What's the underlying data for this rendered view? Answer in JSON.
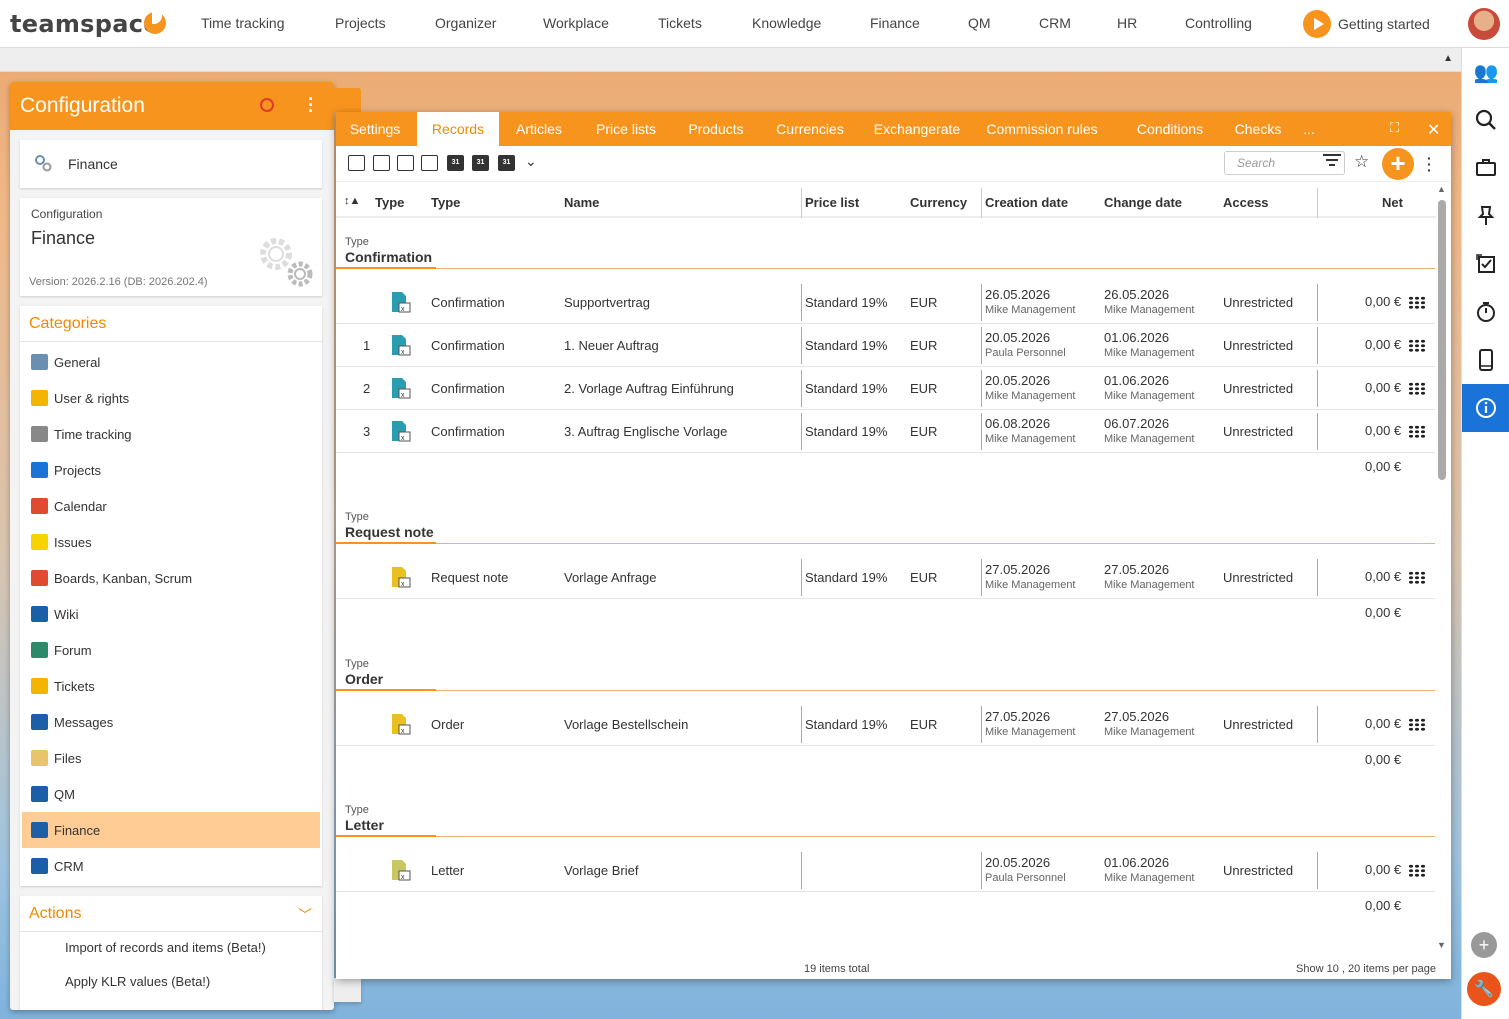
{
  "topbar": {
    "logo": "teamspace",
    "nav": [
      "Time tracking",
      "Projects",
      "Organizer",
      "Workplace",
      "Tickets",
      "Knowledge",
      "Finance",
      "QM",
      "CRM",
      "HR",
      "Controlling"
    ],
    "getting_started": "Getting started"
  },
  "left_panel": {
    "title": "Configuration",
    "current_module": "Finance",
    "config_label": "Configuration",
    "config_name": "Finance",
    "version": "Version: 2026.2.16 (DB: 2026.202.4)",
    "categories_title": "Categories",
    "categories": [
      {
        "label": "General",
        "icon": "gear-icon",
        "color": "#6b8fb0"
      },
      {
        "label": "User & rights",
        "icon": "users-icon",
        "color": "#f5b400"
      },
      {
        "label": "Time tracking",
        "icon": "stopwatch-icon",
        "color": "#888888"
      },
      {
        "label": "Projects",
        "icon": "folder-icon",
        "color": "#1a73d9"
      },
      {
        "label": "Calendar",
        "icon": "calendar-icon",
        "color": "#e04a2f"
      },
      {
        "label": "Issues",
        "icon": "sticky-note-icon",
        "color": "#f5d400"
      },
      {
        "label": "Boards, Kanban, Scrum",
        "icon": "kanban-icon",
        "color": "#e04a2f"
      },
      {
        "label": "Wiki",
        "icon": "wiki-icon",
        "color": "#1a5fa8"
      },
      {
        "label": "Forum",
        "icon": "globe-icon",
        "color": "#2a8a6a"
      },
      {
        "label": "Tickets",
        "icon": "ticket-icon",
        "color": "#f5b400"
      },
      {
        "label": "Messages",
        "icon": "messages-icon",
        "color": "#1a5fa8"
      },
      {
        "label": "Files",
        "icon": "files-icon",
        "color": "#e8c56a"
      },
      {
        "label": "QM",
        "icon": "qm-book-icon",
        "color": "#1a5fa8"
      },
      {
        "label": "Finance",
        "icon": "euro-icon",
        "color": "#1a5fa8",
        "active": true
      },
      {
        "label": "CRM",
        "icon": "contact-card-icon",
        "color": "#1a5fa8"
      }
    ],
    "actions_title": "Actions",
    "actions": [
      "Import of records and items (Beta!)",
      "Apply KLR values (Beta!)"
    ]
  },
  "window": {
    "tabs": [
      "Settings",
      "Records",
      "Articles",
      "Price lists",
      "Products",
      "Currencies",
      "Exchangerate",
      "Commission rules",
      "Conditions",
      "Checks",
      "..."
    ],
    "active_tab": "Records",
    "search_placeholder": "Search",
    "columns": [
      "Type",
      "Type",
      "Name",
      "Price list",
      "Currency",
      "Creation date",
      "Change date",
      "Access",
      "Net"
    ],
    "sort_icon": "↕▲",
    "group_label": "Type",
    "groups": [
      {
        "name": "Confirmation",
        "icon_color": "#2a9db0",
        "rows": [
          {
            "num": "",
            "type": "Confirmation",
            "name": "Supportvertrag",
            "price_list": "Standard 19%",
            "currency": "EUR",
            "created": "26.05.2026",
            "created_by": "Mike Management",
            "changed": "26.05.2026",
            "changed_by": "Mike Management",
            "access": "Unrestricted",
            "net": "0,00 €"
          },
          {
            "num": "1",
            "type": "Confirmation",
            "name": "1. Neuer Auftrag",
            "price_list": "Standard 19%",
            "currency": "EUR",
            "created": "20.05.2026",
            "created_by": "Paula Personnel",
            "changed": "01.06.2026",
            "changed_by": "Mike Management",
            "access": "Unrestricted",
            "net": "0,00 €"
          },
          {
            "num": "2",
            "type": "Confirmation",
            "name": "2. Vorlage Auftrag Einführung",
            "price_list": "Standard 19%",
            "currency": "EUR",
            "created": "20.05.2026",
            "created_by": "Mike Management",
            "changed": "01.06.2026",
            "changed_by": "Mike Management",
            "access": "Unrestricted",
            "net": "0,00 €"
          },
          {
            "num": "3",
            "type": "Confirmation",
            "name": "3. Auftrag Englische Vorlage",
            "price_list": "Standard 19%",
            "currency": "EUR",
            "created": "06.08.2026",
            "created_by": "Mike Management",
            "changed": "06.07.2026",
            "changed_by": "Mike Management",
            "access": "Unrestricted",
            "net": "0,00 €"
          }
        ],
        "sum": "0,00 €"
      },
      {
        "name": "Request note",
        "icon_color": "#e8c020",
        "rows": [
          {
            "num": "",
            "type": "Request note",
            "name": "Vorlage Anfrage",
            "price_list": "Standard 19%",
            "currency": "EUR",
            "created": "27.05.2026",
            "created_by": "Mike Management",
            "changed": "27.05.2026",
            "changed_by": "Mike Management",
            "access": "Unrestricted",
            "net": "0,00 €"
          }
        ],
        "sum": "0,00 €"
      },
      {
        "name": "Order",
        "icon_color": "#e8c020",
        "rows": [
          {
            "num": "",
            "type": "Order",
            "name": "Vorlage Bestellschein",
            "price_list": "Standard 19%",
            "currency": "EUR",
            "created": "27.05.2026",
            "created_by": "Mike Management",
            "changed": "27.05.2026",
            "changed_by": "Mike Management",
            "access": "Unrestricted",
            "net": "0,00 €"
          }
        ],
        "sum": "0,00 €"
      },
      {
        "name": "Letter",
        "icon_color": "#c8c860",
        "rows": [
          {
            "num": "",
            "type": "Letter",
            "name": "Vorlage Brief",
            "price_list": "",
            "currency": "",
            "created": "20.05.2026",
            "created_by": "Paula Personnel",
            "changed": "01.06.2026",
            "changed_by": "Mike Management",
            "access": "Unrestricted",
            "net": "0,00 €"
          }
        ],
        "sum": "0,00 €"
      }
    ],
    "total": "19 items total",
    "show": "Show  10 ,  20  items per page"
  },
  "colors": {
    "accent": "#f7941d",
    "active_category": "#ffcc96",
    "active_sidebar": "#1a73d9"
  }
}
